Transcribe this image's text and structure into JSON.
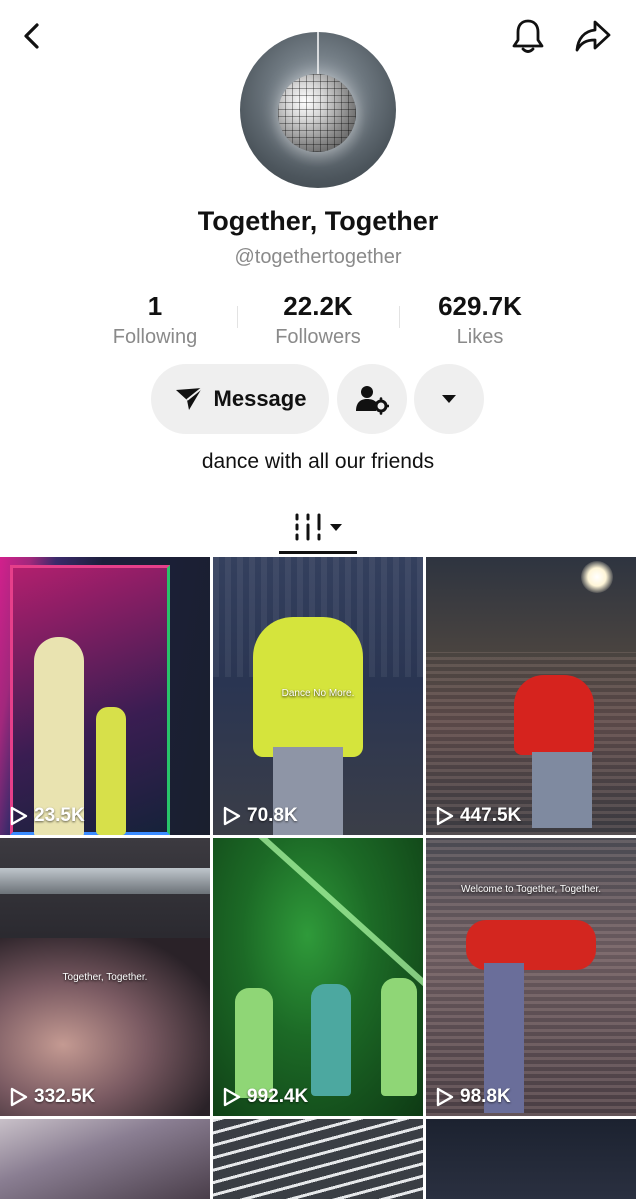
{
  "profile": {
    "name": "Together, Together",
    "handle": "@togethertogether",
    "bio": "dance with all our friends"
  },
  "stats": {
    "following": {
      "value": "1",
      "label": "Following"
    },
    "followers": {
      "value": "22.2K",
      "label": "Followers"
    },
    "likes": {
      "value": "629.7K",
      "label": "Likes"
    }
  },
  "actions": {
    "message_label": "Message",
    "icons": [
      "send-icon",
      "add-friend-icon",
      "dropdown-arrow-icon"
    ]
  },
  "header_icons": [
    "back-arrow-icon",
    "bell-icon",
    "share-icon"
  ],
  "tab": {
    "icon": "grid-videos-icon"
  },
  "videos": [
    {
      "views": "23.5K",
      "caption": ""
    },
    {
      "views": "70.8K",
      "caption": "Dance No More."
    },
    {
      "views": "447.5K",
      "caption": ""
    },
    {
      "views": "332.5K",
      "caption": "Together, Together."
    },
    {
      "views": "992.4K",
      "caption": ""
    },
    {
      "views": "98.8K",
      "caption": "Welcome to Together, Together."
    }
  ]
}
